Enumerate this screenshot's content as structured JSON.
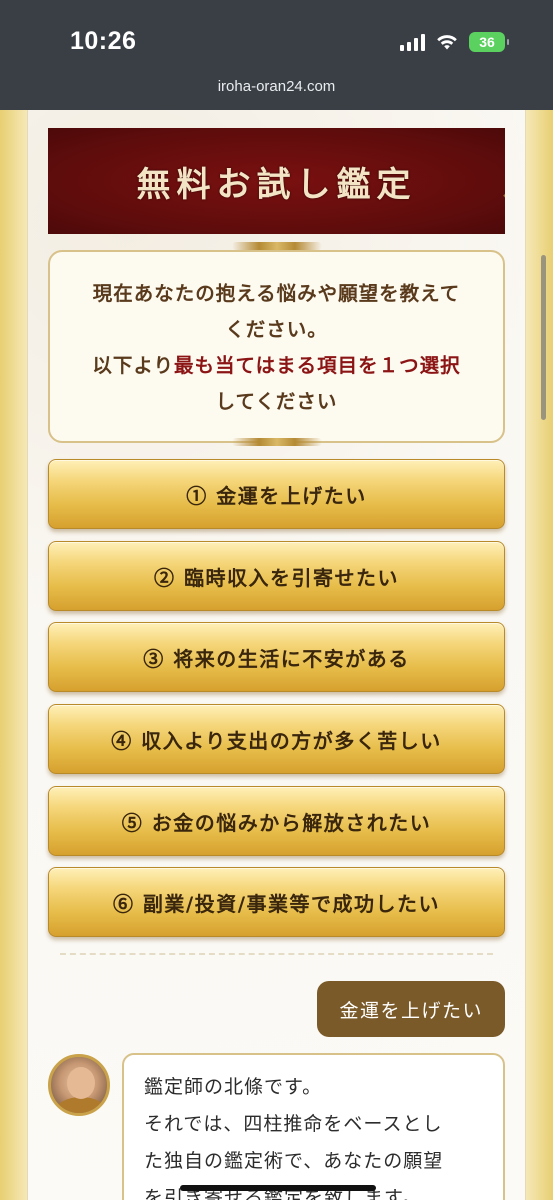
{
  "status_bar": {
    "time": "10:26",
    "battery": "36",
    "battery_color": "#5bd160"
  },
  "browser": {
    "url": "iroha-oran24.com"
  },
  "banner": {
    "title": "無料お試し鑑定"
  },
  "question": {
    "line1": "現在あなたの抱える悩みや願望を教えて",
    "line2": "ください。",
    "line3_pre": "以下より",
    "line3_highlight": "最も当てはまる項目を１つ選択",
    "line4": "してください"
  },
  "options": [
    {
      "label": "① 金運を上げたい"
    },
    {
      "label": "② 臨時収入を引寄せたい"
    },
    {
      "label": "③ 将来の生活に不安がある"
    },
    {
      "label": "④ 収入より支出の方が多く苦しい"
    },
    {
      "label": "⑤ お金の悩みから解放されたい"
    },
    {
      "label": "⑥ 副業/投資/事業等で成功したい"
    }
  ],
  "chat": {
    "user_reply": "金運を上げたい",
    "bot_lines": [
      "鑑定師の北條です。",
      "それでは、四柱推命をベースとし",
      "た独自の鑑定術で、あなたの願望",
      "を引き寄せる鑑定を致します。"
    ]
  },
  "colors": {
    "banner_bg": "#5e0c0c",
    "option_gold": "#e7bd4a",
    "highlight_red": "#8b1414",
    "chat_user_bg": "#7b5a2a"
  }
}
